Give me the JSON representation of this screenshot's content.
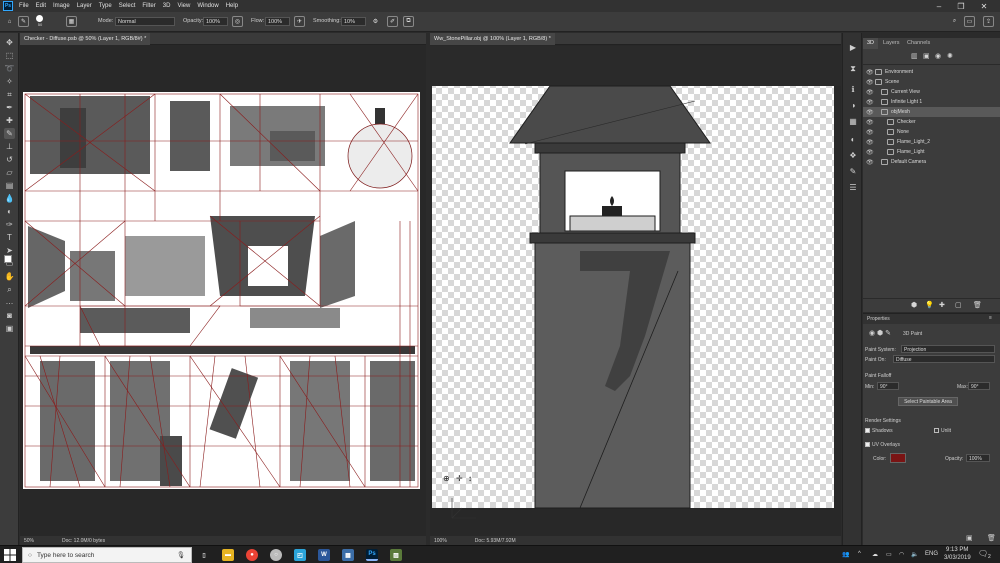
{
  "app": {
    "logo": "Ps"
  },
  "menu": [
    "File",
    "Edit",
    "Image",
    "Layer",
    "Type",
    "Select",
    "Filter",
    "3D",
    "View",
    "Window",
    "Help"
  ],
  "window_controls": [
    "–",
    "❐",
    "✕"
  ],
  "options": {
    "brush_size": "50",
    "mode_label": "Mode:",
    "mode_value": "Normal",
    "opacity_label": "Opacity:",
    "opacity_value": "100%",
    "flow_label": "Flow:",
    "flow_value": "100%",
    "smoothing_label": "Smoothing:",
    "smoothing_value": "10%"
  },
  "documents": [
    {
      "title": "Checker - Diffuse.psb @ 50% (Layer 1, RGB/8#) *",
      "zoom": "50%",
      "doc": "Doc: 12.0M/0 bytes"
    },
    {
      "title": "Ww_StonePillar.obj @ 100% (Layer 1, RGB/8) *",
      "zoom": "100%",
      "doc": "Doc: 5.93M/7.92M"
    }
  ],
  "panel3d": {
    "tabs": [
      "3D",
      "Layers",
      "Channels"
    ],
    "scene": [
      {
        "label": "Environment",
        "indent": 0,
        "selected": false
      },
      {
        "label": "Scene",
        "indent": 0,
        "selected": false
      },
      {
        "label": "Current View",
        "indent": 1,
        "selected": false
      },
      {
        "label": "Infinite Light 1",
        "indent": 1,
        "selected": false
      },
      {
        "label": "objMesh",
        "indent": 1,
        "selected": true
      },
      {
        "label": "Checker",
        "indent": 2,
        "selected": false
      },
      {
        "label": "None",
        "indent": 2,
        "selected": false
      },
      {
        "label": "Flame_Light_2",
        "indent": 2,
        "selected": false
      },
      {
        "label": "Flame_Light",
        "indent": 2,
        "selected": false
      },
      {
        "label": "Default Camera",
        "indent": 1,
        "selected": false
      }
    ]
  },
  "properties": {
    "title": "Properties",
    "subtitle": "3D Paint",
    "paint_system_label": "Paint System:",
    "paint_system_value": "Projection",
    "paint_on_label": "Paint On:",
    "paint_on_value": "Diffuse",
    "falloff_label": "Paint Falloff",
    "min_label": "Min:",
    "min_value": "90°",
    "max_label": "Max:",
    "max_value": "90°",
    "select_area_button": "Select Paintable Area",
    "render_settings_label": "Render Settings",
    "shadows_label": "Shadows",
    "unlit_label": "Unlit",
    "uv_overlays_label": "UV Overlays",
    "color_label": "Color:",
    "overlay_color": "#7a1414",
    "overlay_opacity_label": "Opacity:",
    "overlay_opacity_value": "100%"
  },
  "taskbar": {
    "search_placeholder": "Type here to search",
    "language": "ENG",
    "time": "9:13 PM",
    "date": "3/03/2019",
    "notif_count": "2"
  }
}
